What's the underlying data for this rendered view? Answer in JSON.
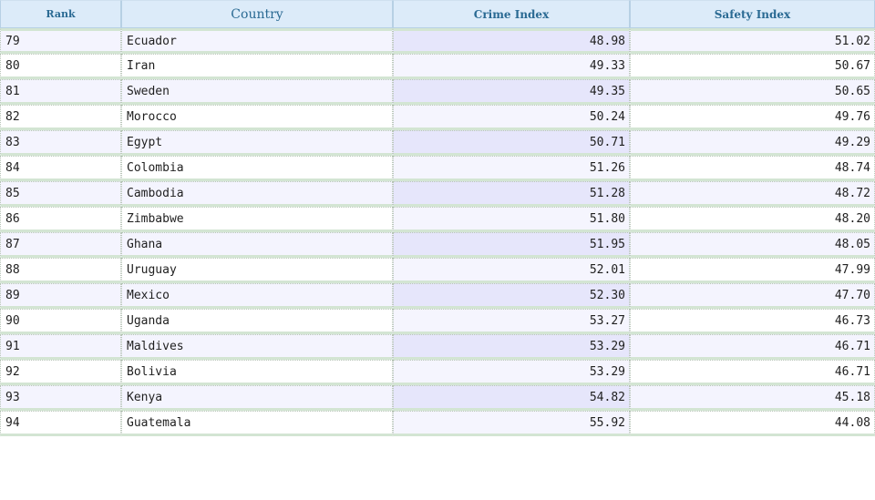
{
  "table": {
    "headers": {
      "rank": "Rank",
      "country": "Country",
      "crime": "Crime Index",
      "safety": "Safety Index"
    },
    "rows": [
      {
        "rank": "79",
        "country": "Ecuador",
        "crime": "48.98",
        "safety": "51.02"
      },
      {
        "rank": "80",
        "country": "Iran",
        "crime": "49.33",
        "safety": "50.67"
      },
      {
        "rank": "81",
        "country": "Sweden",
        "crime": "49.35",
        "safety": "50.65"
      },
      {
        "rank": "82",
        "country": "Morocco",
        "crime": "50.24",
        "safety": "49.76"
      },
      {
        "rank": "83",
        "country": "Egypt",
        "crime": "50.71",
        "safety": "49.29"
      },
      {
        "rank": "84",
        "country": "Colombia",
        "crime": "51.26",
        "safety": "48.74"
      },
      {
        "rank": "85",
        "country": "Cambodia",
        "crime": "51.28",
        "safety": "48.72"
      },
      {
        "rank": "86",
        "country": "Zimbabwe",
        "crime": "51.80",
        "safety": "48.20"
      },
      {
        "rank": "87",
        "country": "Ghana",
        "crime": "51.95",
        "safety": "48.05"
      },
      {
        "rank": "88",
        "country": "Uruguay",
        "crime": "52.01",
        "safety": "47.99"
      },
      {
        "rank": "89",
        "country": "Mexico",
        "crime": "52.30",
        "safety": "47.70"
      },
      {
        "rank": "90",
        "country": "Uganda",
        "crime": "53.27",
        "safety": "46.73"
      },
      {
        "rank": "91",
        "country": "Maldives",
        "crime": "53.29",
        "safety": "46.71"
      },
      {
        "rank": "92",
        "country": "Bolivia",
        "crime": "53.29",
        "safety": "46.71"
      },
      {
        "rank": "93",
        "country": "Kenya",
        "crime": "54.82",
        "safety": "45.18"
      },
      {
        "rank": "94",
        "country": "Guatemala",
        "crime": "55.92",
        "safety": "44.08"
      }
    ]
  },
  "colors": {
    "header_bg": "#dcebf9",
    "header_text": "#2a6a93",
    "row_odd_bg": "#f4f4fe",
    "row_odd_sorted_bg": "#e6e6fb",
    "row_even_bg": "#ffffff",
    "row_separator": "#d3e5d3"
  }
}
